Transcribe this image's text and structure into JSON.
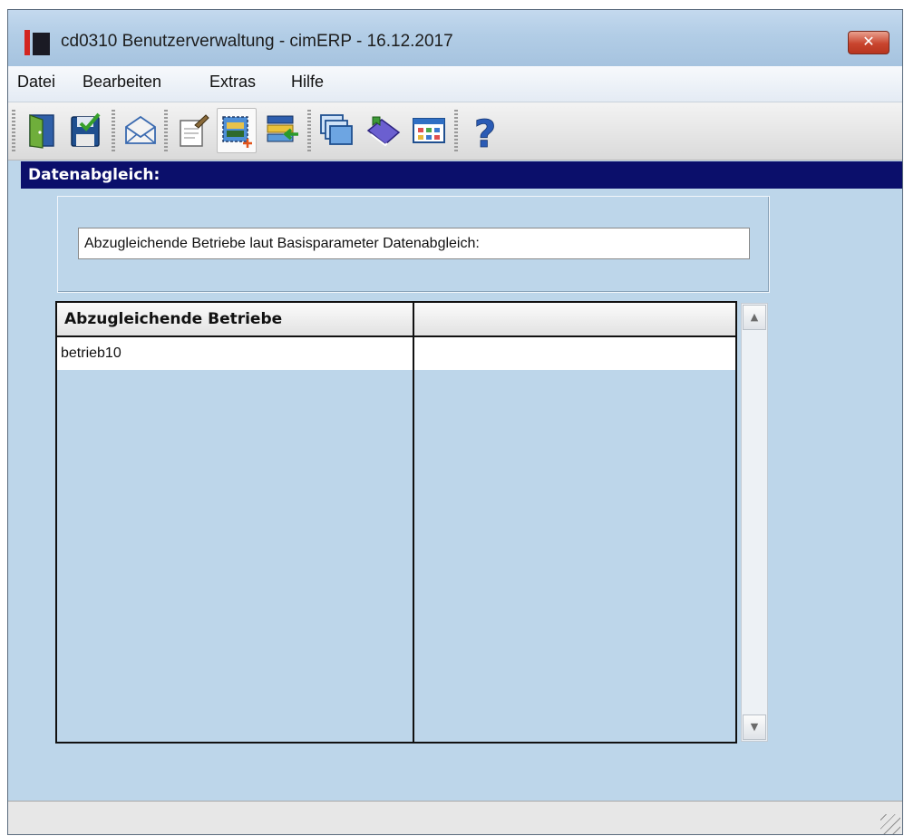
{
  "window": {
    "title": "cd0310 Benutzerverwaltung - cimERP - 16.12.2017",
    "close_label": "✕"
  },
  "menu": {
    "items": [
      "Datei",
      "Bearbeiten",
      "Extras",
      "Hilfe"
    ]
  },
  "toolbar": {
    "buttons": [
      "exit-door-icon",
      "save-icon",
      "mail-icon",
      "edit-note-icon",
      "new-record-icon",
      "import-list-icon",
      "windows-icon",
      "book-tag-icon",
      "table-grid-icon",
      "help-icon"
    ],
    "active_button": "new-record-icon"
  },
  "section": {
    "title": "Datenabgleich:"
  },
  "info": {
    "text": "Abzugleichende Betriebe laut Basisparameter Datenabgleich:"
  },
  "table": {
    "columns": [
      "Abzugleichende Betriebe",
      ""
    ],
    "rows": [
      [
        "betrieb10",
        ""
      ]
    ]
  },
  "colors": {
    "window_bg": "#bdd6ea",
    "section_header": "#0b0f6b",
    "close_button": "#c9452e"
  }
}
